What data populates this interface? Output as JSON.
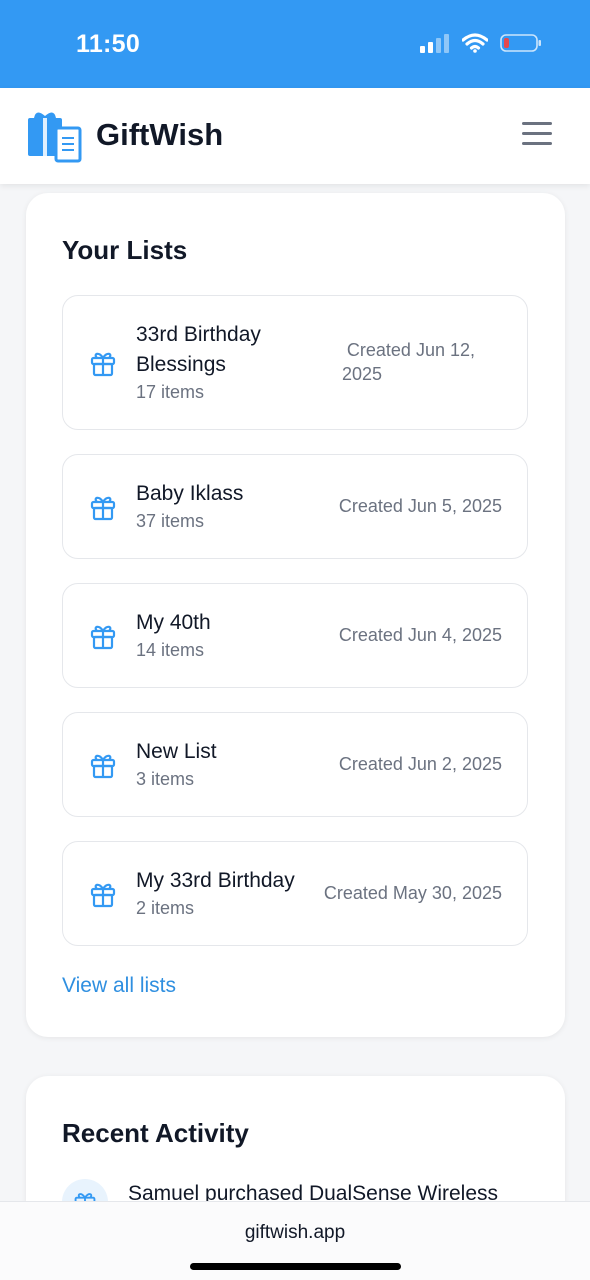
{
  "status_bar": {
    "time": "11:50"
  },
  "header": {
    "app_name": "GiftWish"
  },
  "lists_section": {
    "title": "Your Lists",
    "items": [
      {
        "name_line1": "33rd Birthday",
        "name_line2": "Blessings",
        "count": "17 items",
        "date_line1": "Created Jun 12,",
        "date_line2": "2025"
      },
      {
        "name": "Baby Iklass",
        "count": "37 items",
        "date": "Created Jun 5, 2025"
      },
      {
        "name": "My 40th",
        "count": "14 items",
        "date": "Created Jun 4, 2025"
      },
      {
        "name": "New List",
        "count": "3 items",
        "date": "Created Jun 2, 2025"
      },
      {
        "name": "My 33rd Birthday",
        "count": "2 items",
        "date": "Created May 30, 2025"
      }
    ],
    "view_all_label": "View all lists"
  },
  "activity_section": {
    "title": "Recent Activity",
    "entry": {
      "user_action": "Samuel purchased ",
      "item": "DualSense Wireless"
    }
  },
  "browser": {
    "url": "giftwish.app"
  },
  "icons": {
    "list_item_icon": "gift-icon",
    "menu": "hamburger-menu-icon",
    "logo": "gift-box-logo-icon"
  },
  "colors": {
    "status_bar": "#3399f3",
    "accent": "#2f8fe0",
    "text_primary": "#111827",
    "text_secondary": "#6b7280"
  }
}
